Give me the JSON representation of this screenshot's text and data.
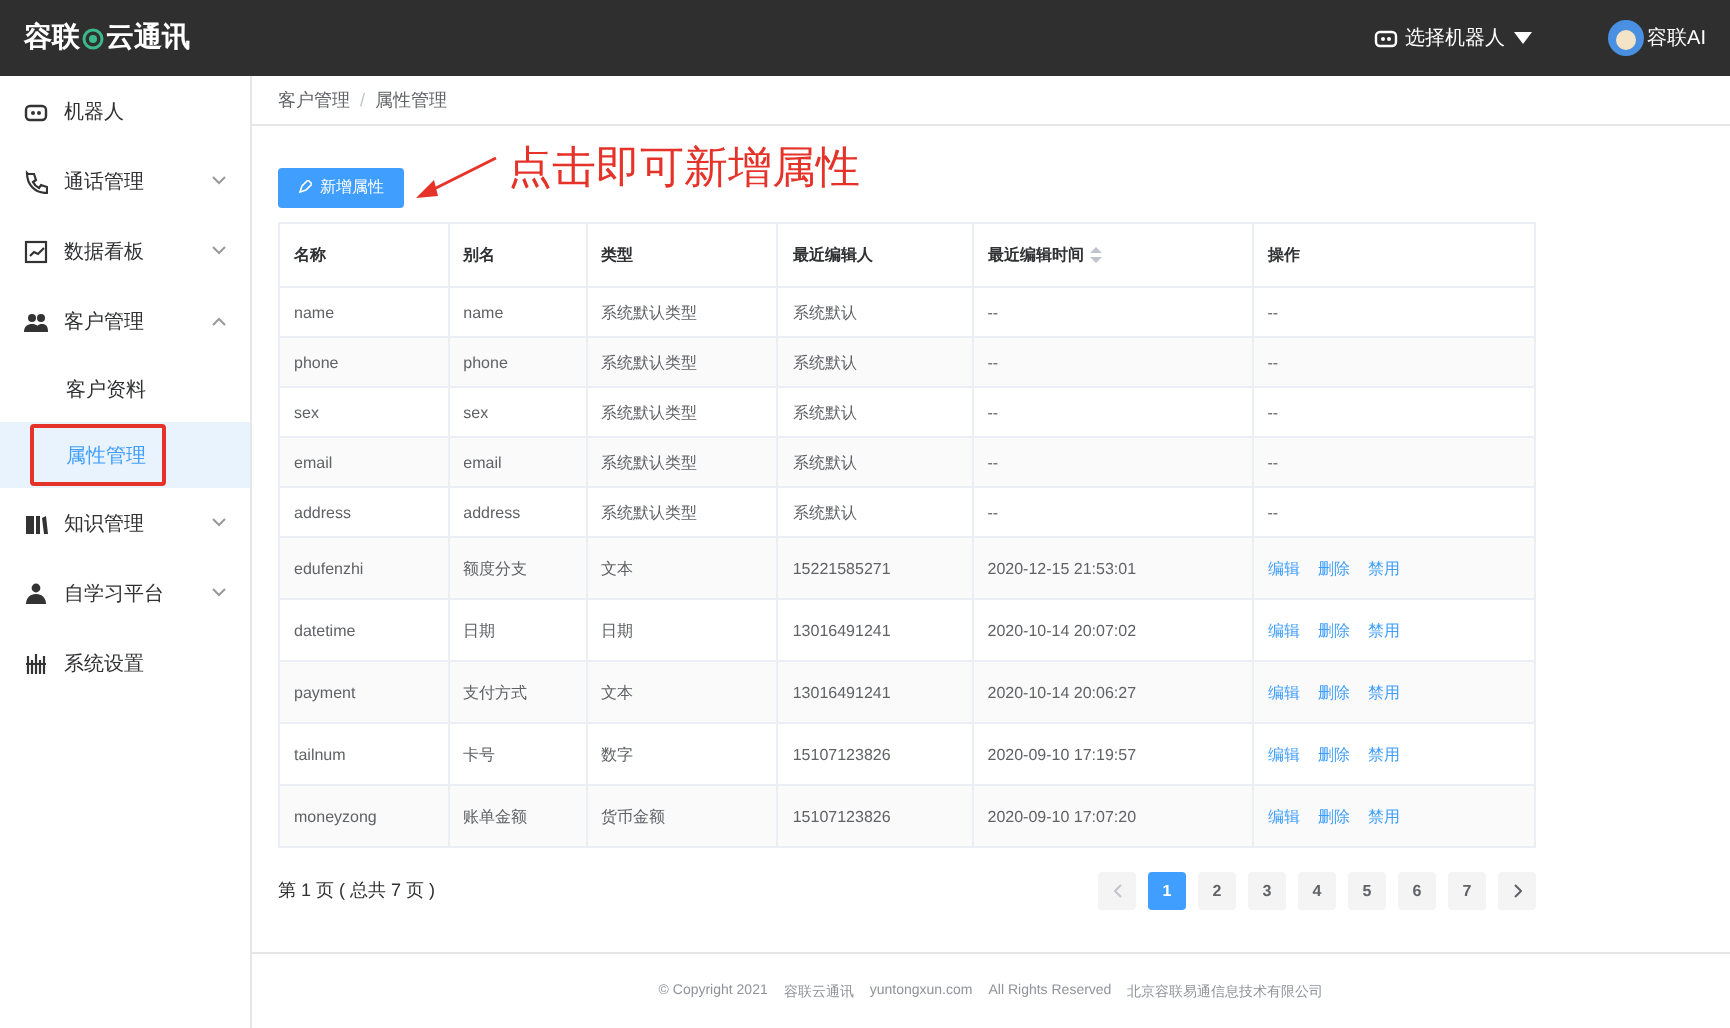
{
  "header": {
    "logo": "容联",
    "logo_suffix": "云通讯",
    "robot_select": "选择机器人",
    "user": "容联AI"
  },
  "sidebar": {
    "items": [
      {
        "label": "机器人"
      },
      {
        "label": "通话管理",
        "expanded": false
      },
      {
        "label": "数据看板",
        "expanded": false
      },
      {
        "label": "客户管理",
        "expanded": true,
        "children": [
          {
            "label": "客户资料",
            "selected": false,
            "highlighted": false
          },
          {
            "label": "属性管理",
            "selected": true,
            "highlighted": true
          }
        ]
      },
      {
        "label": "知识管理",
        "expanded": false
      },
      {
        "label": "自学习平台",
        "expanded": false
      },
      {
        "label": "系统设置"
      }
    ]
  },
  "breadcrumb": {
    "items": [
      "客户管理",
      "属性管理"
    ],
    "separator": "/"
  },
  "add_button": "新增属性",
  "annotation": "点击即可新增属性",
  "table": {
    "columns": [
      {
        "label": "名称",
        "sortable": false
      },
      {
        "label": "别名",
        "sortable": false
      },
      {
        "label": "类型",
        "sortable": false
      },
      {
        "label": "最近编辑人",
        "sortable": false
      },
      {
        "label": "最近编辑时间",
        "sortable": true
      },
      {
        "label": "操作",
        "sortable": false
      }
    ],
    "rows": [
      {
        "cells": [
          "name",
          "name",
          "系统默认类型",
          "系统默认",
          "--"
        ],
        "operation": "--"
      },
      {
        "cells": [
          "phone",
          "phone",
          "系统默认类型",
          "系统默认",
          "--"
        ],
        "operation": "--"
      },
      {
        "cells": [
          "sex",
          "sex",
          "系统默认类型",
          "系统默认",
          "--"
        ],
        "operation": "--"
      },
      {
        "cells": [
          "email",
          "email",
          "系统默认类型",
          "系统默认",
          "--"
        ],
        "operation": "--"
      },
      {
        "cells": [
          "address",
          "address",
          "系统默认类型",
          "系统默认",
          "--"
        ],
        "operation": "--"
      },
      {
        "cells": [
          "edufenzhi",
          "额度分支",
          "文本",
          "15221585271",
          "2020-12-15 21:53:01"
        ],
        "actions": [
          "编辑",
          "删除",
          "禁用"
        ]
      },
      {
        "cells": [
          "datetime",
          "日期",
          "日期",
          "13016491241",
          "2020-10-14 20:07:02"
        ],
        "actions": [
          "编辑",
          "删除",
          "禁用"
        ]
      },
      {
        "cells": [
          "payment",
          "支付方式",
          "文本",
          "13016491241",
          "2020-10-14 20:06:27"
        ],
        "actions": [
          "编辑",
          "删除",
          "禁用"
        ]
      },
      {
        "cells": [
          "tailnum",
          "卡号",
          "数字",
          "15107123826",
          "2020-09-10 17:19:57"
        ],
        "actions": [
          "编辑",
          "删除",
          "禁用"
        ]
      },
      {
        "cells": [
          "moneyzong",
          "账单金额",
          "货币金额",
          "15107123826",
          "2020-09-10 17:07:20"
        ],
        "actions": [
          "编辑",
          "删除",
          "禁用"
        ]
      }
    ]
  },
  "pagination": {
    "summary": "第 1 页 ( 总共 7 页 )",
    "pages": [
      {
        "label": "1",
        "selected": true
      },
      {
        "label": "2",
        "selected": false
      },
      {
        "label": "3",
        "selected": false
      },
      {
        "label": "4",
        "selected": false
      },
      {
        "label": "5",
        "selected": false
      },
      {
        "label": "6",
        "selected": false
      },
      {
        "label": "7",
        "selected": false
      }
    ]
  },
  "footer": [
    "© Copyright 2021",
    "容联云通讯",
    "yuntongxun.com",
    "All Rights Reserved",
    "北京容联易通信息技术有限公司"
  ]
}
